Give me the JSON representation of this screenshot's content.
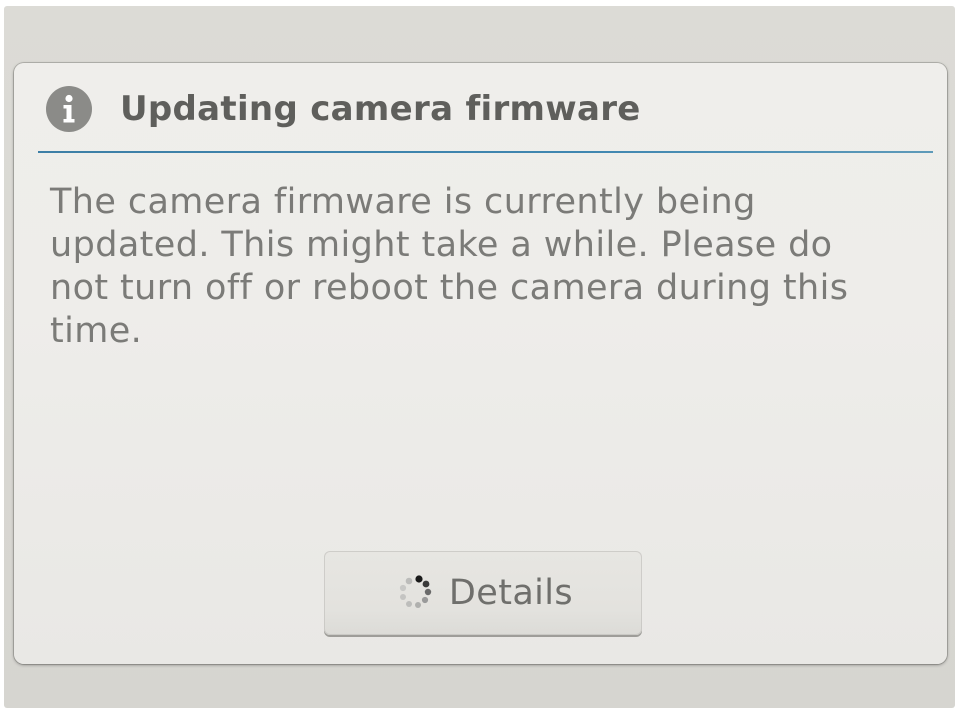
{
  "dialog": {
    "title": "Updating camera firmware",
    "title_icon": "info-icon",
    "message": "The camera firmware is currently being updated. This might take a while. Please do not turn off or reboot the camera during this time.",
    "details_button": {
      "label": "Details",
      "icon": "loading-spinner-icon"
    }
  },
  "colors": {
    "title_text": "#5f5f5c",
    "body_text": "#7b7b78",
    "accent_rule": "#3f86b0",
    "icon_badge": "#8b8b88"
  }
}
